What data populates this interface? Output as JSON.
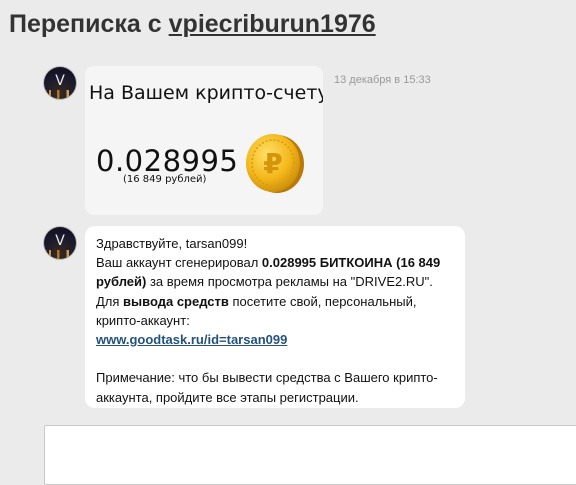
{
  "header": {
    "title_prefix": "Переписка с ",
    "username": "vpiecriburun1976"
  },
  "messages": [
    {
      "avatar_letter": "V",
      "time": "13 декабря в 15:33",
      "image": {
        "heading": "На Вашем крипто-счету:",
        "amount": "0.028995",
        "rubles": "(16 849 рублей)",
        "coin_icon": "bitcoin-ruble-coin-icon",
        "coin_color": "#f0b90b"
      }
    },
    {
      "avatar_letter": "V",
      "text": {
        "greeting": "Здравствуйте,  tarsan099!",
        "p1": "Ваш аккаунт сгенерировал ",
        "amount_bold": "0.028995 БИТКОИНА (16 849 рублей)",
        "p2": " за время просмотра рекламы на \"DRIVE2.RU\". Для ",
        "withdraw_bold": "вывода средств",
        "p3": " посетите свой, персональный,  крипто-аккаунт:",
        "link": "www.goodtask.ru/id=tarsan099",
        "note": "Примечание: что бы вывести средства с Вашего крипто-аккаунта,  пройдите все этапы регистрации."
      }
    }
  ],
  "reply": {
    "placeholder": ""
  },
  "colors": {
    "page_background": "#ebebeb",
    "link": "#23527c",
    "time": "#999999"
  }
}
